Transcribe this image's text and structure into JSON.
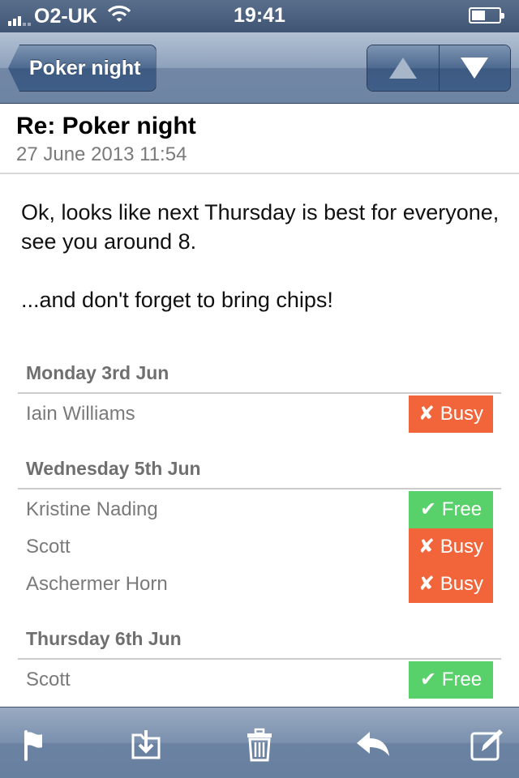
{
  "status_bar": {
    "carrier": "O2-UK",
    "time": "19:41",
    "battery_level": 0.5
  },
  "nav": {
    "back_label": "Poker night",
    "previous_icon": "up-arrow-icon",
    "next_icon": "down-arrow-icon"
  },
  "message": {
    "subject": "Re: Poker night",
    "date": "27 June 2013 11:54",
    "body_line1": "Ok, looks like next Thursday is best for everyone, see you around 8.",
    "body_line2": "...and don't forget to bring chips!"
  },
  "schedule": [
    {
      "day": "Monday 3rd Jun",
      "people": [
        {
          "name": "Iain Williams",
          "status": "✘ Busy",
          "kind": "busy"
        }
      ]
    },
    {
      "day": "Wednesday 5th Jun",
      "people": [
        {
          "name": "Kristine Nading",
          "status": "✔ Free",
          "kind": "free"
        },
        {
          "name": "Scott",
          "status": "✘ Busy",
          "kind": "busy"
        },
        {
          "name": "Aschermer Horn",
          "status": "✘ Busy",
          "kind": "busy"
        }
      ]
    },
    {
      "day": "Thursday 6th Jun",
      "people": [
        {
          "name": "Scott",
          "status": "✔ Free",
          "kind": "free"
        }
      ]
    }
  ],
  "colors": {
    "busy": "#f2653a",
    "free": "#58d16b",
    "bar": "#6d84a3"
  },
  "toolbar": {
    "icons": [
      "flag-icon",
      "move-to-folder-icon",
      "trash-icon",
      "reply-icon",
      "compose-icon"
    ]
  }
}
